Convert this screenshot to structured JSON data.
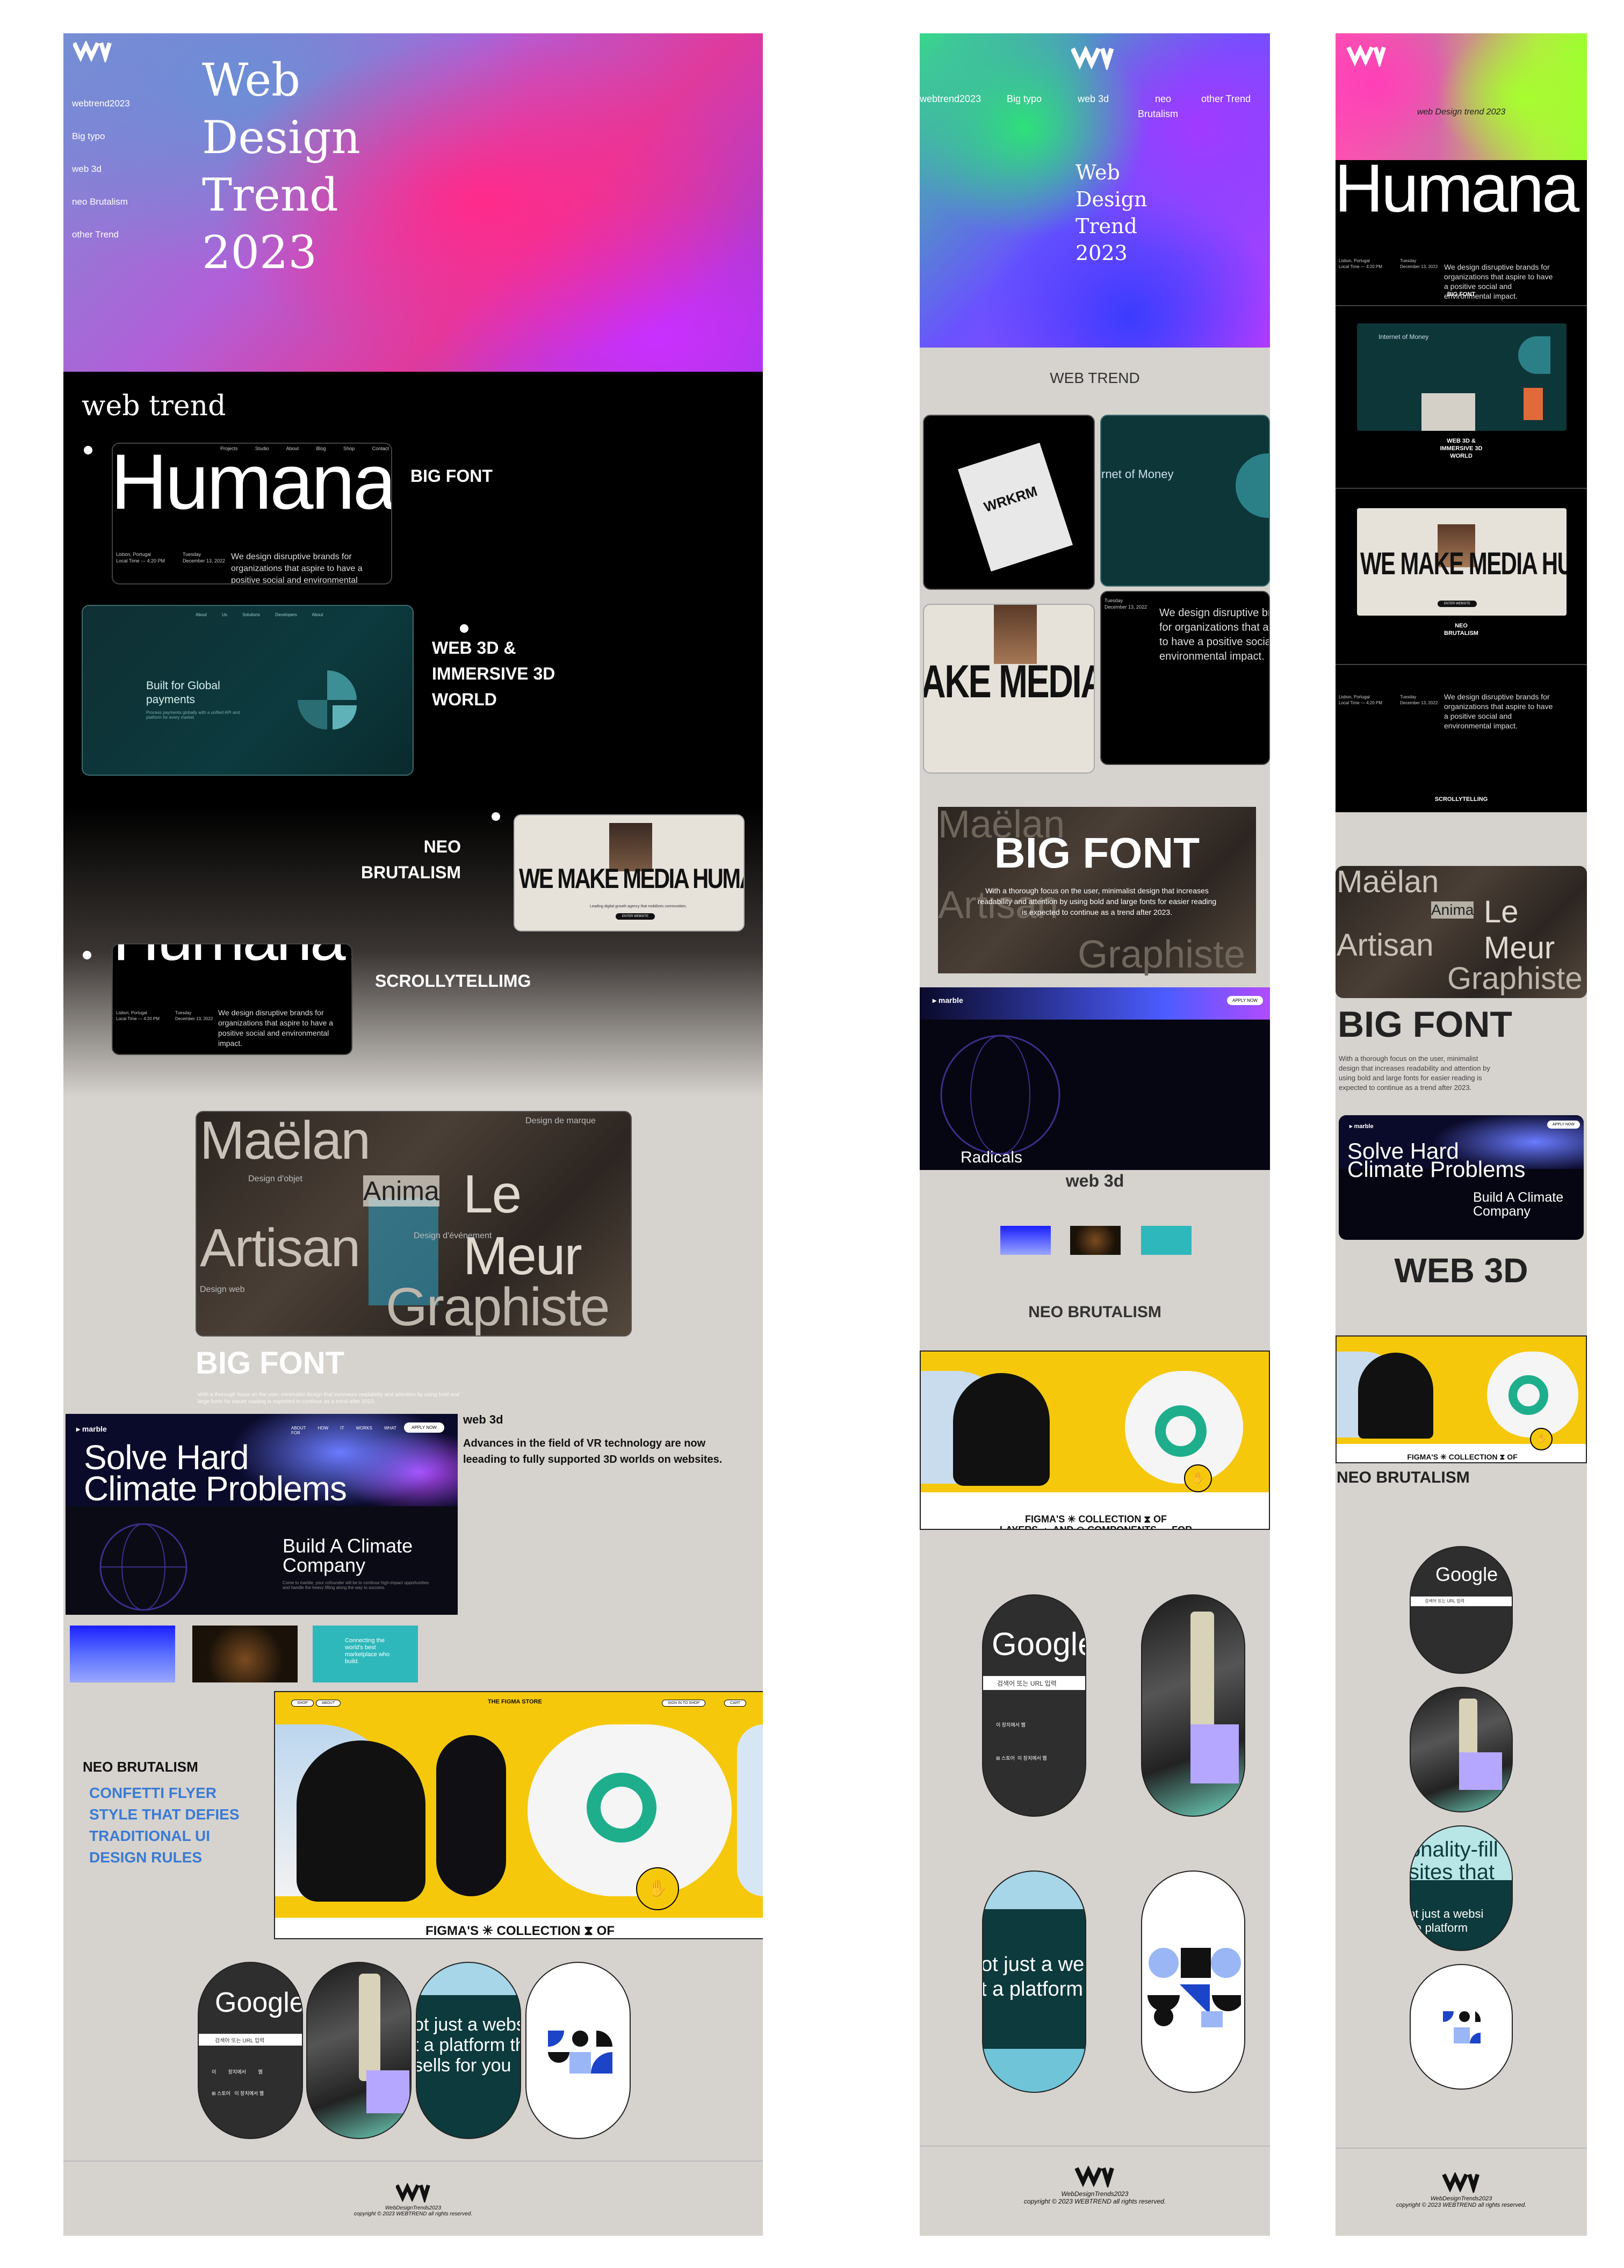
{
  "brand": {
    "logo": "W-logo-icon",
    "name": "WEB TREND"
  },
  "desktop": {
    "nav": [
      "webtrend2023",
      "Big typo",
      "web 3d",
      "neo Brutalism",
      "other Trend"
    ],
    "hero_title": [
      "Web",
      "Design",
      "Trend",
      "2023"
    ],
    "section_title": "web trend",
    "trends": {
      "big_font": "BIG FONT",
      "web3d": [
        "WEB 3D &",
        "IMMERSIVE 3D",
        "WORLD"
      ],
      "neo": [
        "NEO",
        "BRUTALISM"
      ],
      "scroll": "SCROLLYTELLIMG"
    },
    "humana": {
      "word": "Humana",
      "menu": [
        "Projects",
        "Studio",
        "About",
        "Blog",
        "Shop",
        "Contact"
      ],
      "location": [
        "Lisbon, Portugal",
        "Local Time — 4:20 PM"
      ],
      "date": [
        "Tuesday",
        "December 13, 2022"
      ],
      "tagline": "We design disruptive brands for organizations that aspire to have a positive social and environmental impact."
    },
    "payments": {
      "title": "Built for Global payments",
      "body": "Process payments globally with a unified API and platform for every market.",
      "nav": [
        "About Us",
        "Solutions",
        "Developers",
        "About"
      ]
    },
    "media_human": {
      "headline": "WE MAKE MEDIA HUMAN",
      "sub": "Leading digital growth agency that mobilizes communities.",
      "cta": "ENTER WEBSITE"
    },
    "typo_words": [
      "Maëlan",
      "Design de marque",
      "Design d'objet",
      "Anima",
      "Le Meur",
      "Artisan",
      "Design d'événement",
      "Design web",
      "Graphiste"
    ],
    "big_font_heading": "BIG FONT",
    "big_font_body": "With a thorough focus on the user, minimalist design that increases readability and attention by using bold and large fonts for easier reading is expected to continue as a trend after 2023.",
    "marble": {
      "brand": "marble",
      "headline": [
        "Solve Hard",
        "Climate Problems"
      ],
      "sub": [
        "Build A Climate",
        "Company"
      ],
      "cta": "APPLY NOW",
      "menu": [
        "ABOUT",
        "HOW IT WORKS",
        "WHAT WE LOOK FOR"
      ],
      "body": "Come to marble, your cofounder will be to continue high-impact opportunities and handle the heavy lifting along the way to success."
    },
    "web3d_label": "web 3d",
    "web3d_desc": [
      "Advances in the field of VR technology are now",
      "leeading to fully supported 3D worlds on websites."
    ],
    "teal_text": [
      "Connecting the",
      "world's best",
      "marketplace who",
      "build."
    ],
    "neo_label": "NEO BRUTALISM",
    "neo_desc": [
      "CONFETTI FLYER",
      "STYLE THAT DEFIES",
      "TRADITIONAL UI",
      "DESIGN RULES"
    ],
    "figma": {
      "store": "THE FIGMA STORE",
      "btn_left": [
        "SHOP",
        "ABOUT"
      ],
      "btn_right": [
        "SIGN IN TO SHOP",
        "CART"
      ],
      "caption": "FIGMA'S ✳ COLLECTION ⧗ OF",
      "caption2": "LAYERS ▲ AND ◎ COMPONENTS ↔ FOR"
    },
    "google": {
      "word": "Google",
      "search": "검색어 또는 URL 입력",
      "items": [
        "이 장치에서 웹",
        "이 장치에서 웹",
        "이 장치에서 웹"
      ],
      "items2": [
        "⊞ 스토어",
        "이 장치에서 웹"
      ]
    },
    "pill_text": [
      "ot just a websi",
      "t a platform th",
      "sells for you"
    ],
    "footer": {
      "site": "WebDesignTrends2023",
      "copy": "copyright © 2023 WEBTREND all rights reserved."
    }
  },
  "tablet": {
    "nav": [
      "webtrend2023",
      "Big typo",
      "web 3d",
      "neo",
      "Brutalism",
      "other Trend"
    ],
    "hero_title": [
      "Web",
      "Design",
      "Trend",
      "2023"
    ],
    "section_label": "WEB TREND",
    "workroom": "WRKRM",
    "money": "rnet of Money",
    "media": "AKE MEDIA HI",
    "big_font": "BIG FONT",
    "radicals": "Radicals",
    "web3d": "web 3d",
    "neo": "NEO BRUTALISM"
  },
  "mobile": {
    "title": "web Design trend 2023",
    "word": "Humana",
    "labels": {
      "big": "BIG FONT",
      "web3d": [
        "WEB 3D &",
        "IMMERSIVE 3D",
        "WORLD"
      ],
      "neo": [
        "NEO",
        "BRUTALISM"
      ],
      "scroll": "SCROLLYTELLING"
    },
    "internet": "Internet of Money",
    "big_font": "BIG FONT",
    "big_font_body": "With a thorough focus on the user, minimalist design that increases readability and attention by using bold and large fonts for easier reading is expected to continue as a trend after 2023.",
    "web3d": "WEB 3D",
    "neo": "NEO BRUTALISM",
    "pill_text": [
      "onality-fill",
      "sites that",
      "ot just a websi",
      "t a platform"
    ]
  },
  "colors": {
    "bg_gray": "#d6d2cd",
    "black": "#000000",
    "yellow": "#f6c80c",
    "blue": "#3a7bd5",
    "teal": "#0f3a3d"
  }
}
